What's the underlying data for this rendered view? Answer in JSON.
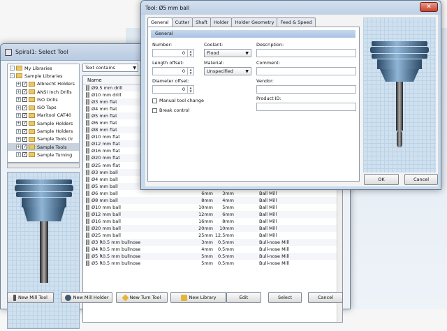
{
  "select_window": {
    "title": "Spiral1: Select Tool",
    "tree": [
      {
        "label": "My Libraries",
        "exp": "-",
        "check": false,
        "indent": 0
      },
      {
        "label": "Sample Libraries",
        "exp": "-",
        "check": false,
        "indent": 0
      },
      {
        "label": "Albrecht Holders",
        "exp": "+",
        "check": true,
        "indent": 1
      },
      {
        "label": "ANSI Inch Drills",
        "exp": "+",
        "check": true,
        "indent": 1
      },
      {
        "label": "ISO Drills",
        "exp": "+",
        "check": true,
        "indent": 1
      },
      {
        "label": "ISO Taps",
        "exp": "+",
        "check": true,
        "indent": 1
      },
      {
        "label": "Maritool CAT40",
        "exp": "+",
        "check": true,
        "indent": 1
      },
      {
        "label": "Sample Holders",
        "exp": "+",
        "check": true,
        "indent": 1
      },
      {
        "label": "Sample Holders",
        "exp": "+",
        "check": true,
        "indent": 1
      },
      {
        "label": "Sample Tools (Ir",
        "exp": "+",
        "check": true,
        "indent": 1
      },
      {
        "label": "Sample Tools",
        "exp": "+",
        "check": true,
        "indent": 1,
        "selected": true
      },
      {
        "label": "Sample Turning",
        "exp": "+",
        "check": true,
        "indent": 1
      }
    ],
    "filter": "Text contains",
    "list_header": "Name",
    "rows": [
      {
        "name": "Ø9.5 mm drill",
        "d": "",
        "l": "",
        "type": ""
      },
      {
        "name": "Ø10 mm drill",
        "d": "",
        "l": "",
        "type": ""
      },
      {
        "name": "Ø3 mm flat",
        "d": "",
        "l": "",
        "type": ""
      },
      {
        "name": "Ø4 mm flat",
        "d": "",
        "l": "",
        "type": ""
      },
      {
        "name": "Ø5 mm flat",
        "d": "",
        "l": "",
        "type": ""
      },
      {
        "name": "Ø6 mm flat",
        "d": "",
        "l": "",
        "type": ""
      },
      {
        "name": "Ø8 mm flat",
        "d": "",
        "l": "",
        "type": ""
      },
      {
        "name": "Ø10 mm flat",
        "d": "",
        "l": "",
        "type": ""
      },
      {
        "name": "Ø12 mm flat",
        "d": "",
        "l": "",
        "type": ""
      },
      {
        "name": "Ø16 mm flat",
        "d": "",
        "l": "",
        "type": ""
      },
      {
        "name": "Ø20 mm flat",
        "d": "",
        "l": "",
        "type": ""
      },
      {
        "name": "Ø25 mm flat",
        "d": "",
        "l": "",
        "type": ""
      },
      {
        "name": "Ø3 mm ball",
        "d": "",
        "l": "",
        "type": ""
      },
      {
        "name": "Ø4 mm ball",
        "d": "",
        "l": "",
        "type": ""
      },
      {
        "name": "Ø5 mm ball",
        "d": "5mm",
        "l": "2.5mm",
        "type": "Ball Mill"
      },
      {
        "name": "Ø6 mm ball",
        "d": "6mm",
        "l": "3mm",
        "type": "Ball Mill"
      },
      {
        "name": "Ø8 mm ball",
        "d": "8mm",
        "l": "4mm",
        "type": "Ball Mill"
      },
      {
        "name": "Ø10 mm ball",
        "d": "10mm",
        "l": "5mm",
        "type": "Ball Mill"
      },
      {
        "name": "Ø12 mm ball",
        "d": "12mm",
        "l": "6mm",
        "type": "Ball Mill"
      },
      {
        "name": "Ø16 mm ball",
        "d": "16mm",
        "l": "8mm",
        "type": "Ball Mill"
      },
      {
        "name": "Ø20 mm ball",
        "d": "20mm",
        "l": "10mm",
        "type": "Ball Mill"
      },
      {
        "name": "Ø25 mm ball",
        "d": "25mm",
        "l": "12.5mm",
        "type": "Ball Mill"
      },
      {
        "name": "Ø3 R0.5 mm bullnose",
        "d": "3mm",
        "l": "0.5mm",
        "type": "Bull-nose Mill"
      },
      {
        "name": "Ø4 R0.5 mm bullnose",
        "d": "4mm",
        "l": "0.5mm",
        "type": "Bull-nose Mill"
      },
      {
        "name": "Ø5 R0.5 mm bullnose",
        "d": "5mm",
        "l": "0.5mm",
        "type": "Bull-nose Mill"
      },
      {
        "name": "Ø5 R0.5 mm bullnose",
        "d": "5mm",
        "l": "0.5mm",
        "type": "Bull-nose Mill"
      }
    ],
    "buttons": {
      "new_mill_tool": "New Mill Tool",
      "new_mill_holder": "New Mill Holder",
      "new_turn_tool": "New Turn Tool",
      "new_library": "New Library",
      "edit": "Edit",
      "select": "Select",
      "cancel": "Cancel"
    }
  },
  "tool_dialog": {
    "title": "Tool: Ø5 mm ball",
    "tabs": [
      "General",
      "Cutter",
      "Shaft",
      "Holder",
      "Holder Geometry",
      "Feed & Speed"
    ],
    "section": "General",
    "labels": {
      "number": "Number:",
      "coolant": "Coolant:",
      "description": "Description:",
      "length_offset": "Length offset:",
      "material": "Material:",
      "comment": "Comment:",
      "diameter_offset": "Diameter offset:",
      "vendor": "Vendor:",
      "product_id": "Product ID:",
      "manual_tool_change": "Manual tool change",
      "break_control": "Break control"
    },
    "values": {
      "number": "0",
      "coolant": "Flood",
      "length_offset": "0",
      "material": "Unspecified",
      "diameter_offset": "0"
    },
    "ok": "OK",
    "cancel": "Cancel"
  }
}
